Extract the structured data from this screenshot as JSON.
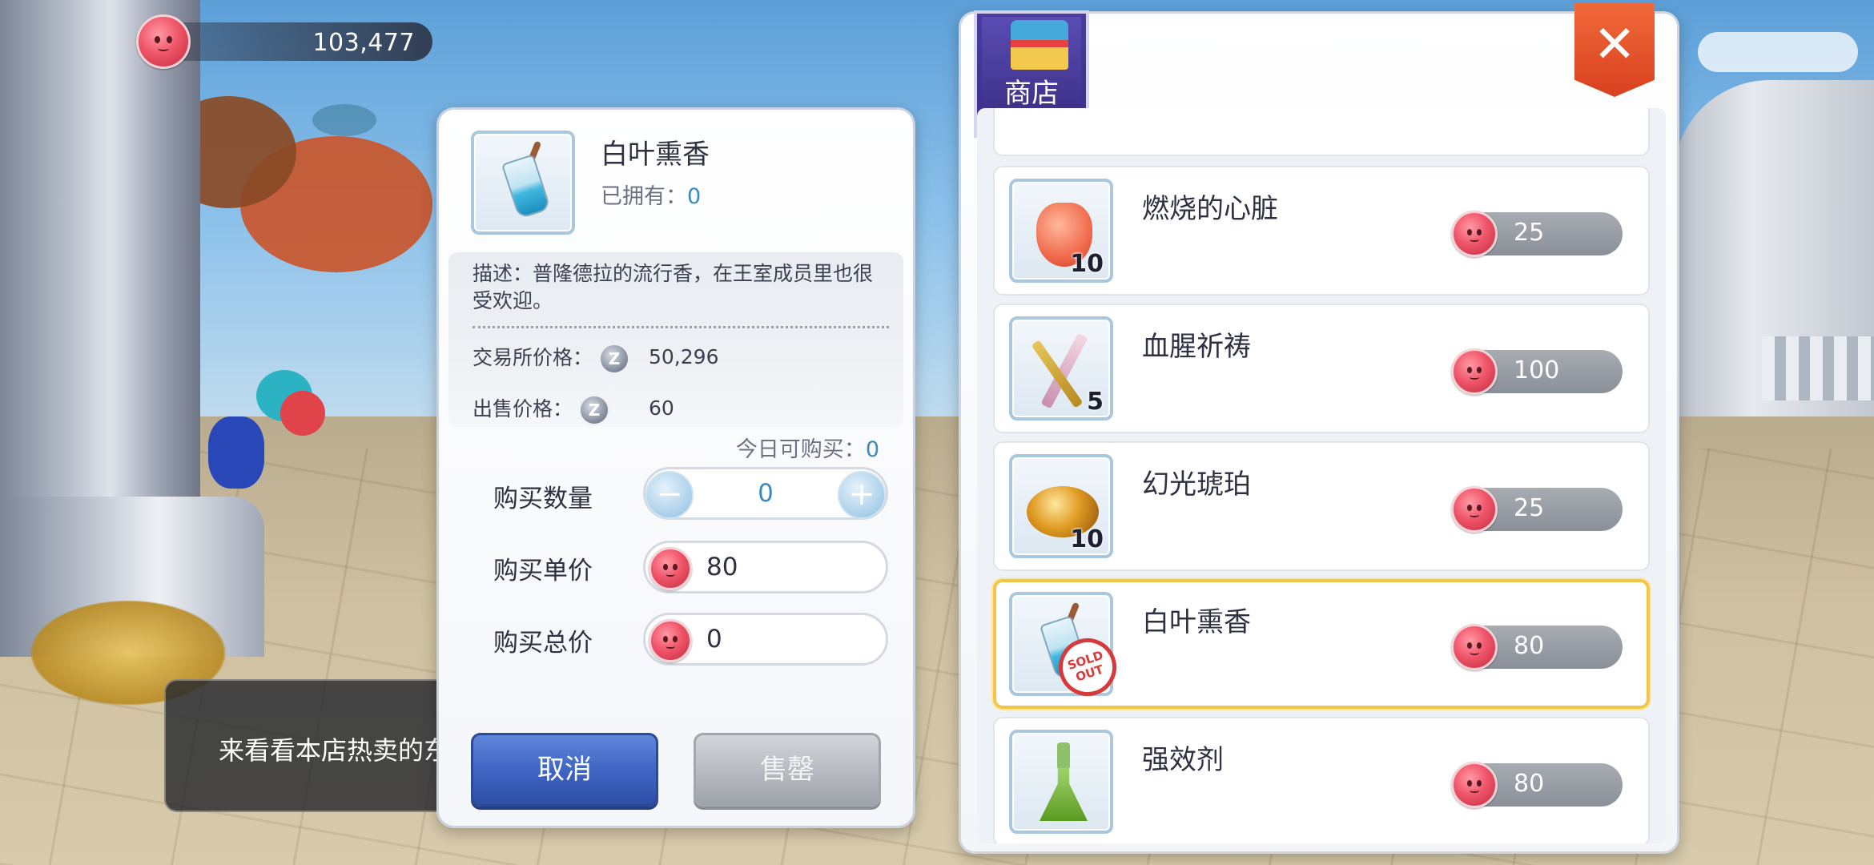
{
  "currency": {
    "amount": "103,477",
    "icon": "poring-coin-icon"
  },
  "npc_dialog": {
    "text": "来看看本店热卖的东"
  },
  "detail": {
    "item_name": "白叶熏香",
    "owned_label": "已拥有：",
    "owned_value": "0",
    "description": "描述：普隆德拉的流行香，在王室成员里也很受欢迎。",
    "exchange_price_label": "交易所价格：",
    "exchange_price_value": "50,296",
    "sell_price_label": "出售价格：",
    "sell_price_value": "60",
    "zeny_symbol": "Z",
    "today_label": "今日可购买：",
    "today_value": "0",
    "quantity_label": "购买数量",
    "quantity_value": "0",
    "minus_label": "−",
    "plus_label": "+",
    "unit_price_label": "购买单价",
    "unit_price_value": "80",
    "total_price_label": "购买总价",
    "total_price_value": "0",
    "cancel_button": "取消",
    "soldout_button": "售罄"
  },
  "shop": {
    "title": "商店",
    "close_symbol": "✕",
    "items": [
      {
        "name": "燃烧的心脏",
        "count": "10",
        "price": "25",
        "icon": "heart-icon"
      },
      {
        "name": "血腥祈祷",
        "count": "5",
        "price": "100",
        "icon": "crossed-daggers-icon"
      },
      {
        "name": "幻光琥珀",
        "count": "10",
        "price": "25",
        "icon": "amber-icon"
      },
      {
        "name": "白叶熏香",
        "count": "",
        "price": "80",
        "icon": "incense-bottle-icon",
        "sold_out": "SOLD OUT",
        "selected": true
      },
      {
        "name": "强效剂",
        "count": "",
        "price": "80",
        "icon": "green-flask-icon"
      }
    ]
  },
  "colors": {
    "accent_blue": "#3a8ac2",
    "cancel_blue": "#3d63c2",
    "selected_border": "#f3c64a",
    "close_red": "#d9401f"
  }
}
